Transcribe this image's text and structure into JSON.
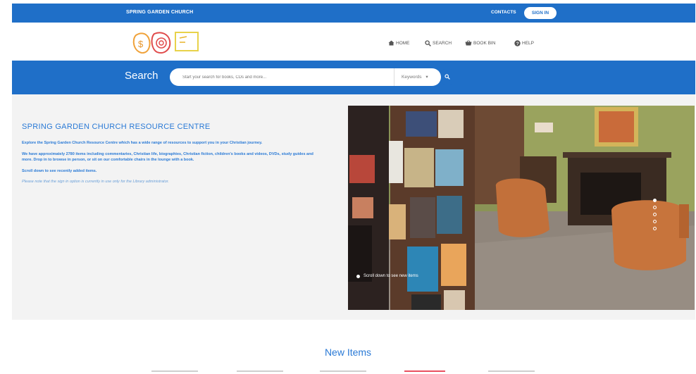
{
  "header": {
    "church_name": "SPRING GARDEN CHURCH",
    "contacts_label": "CONTACTS",
    "signin_label": "SIGN IN"
  },
  "nav": {
    "items": [
      {
        "label": "HOME",
        "icon": "home-icon"
      },
      {
        "label": "SEARCH",
        "icon": "search-icon"
      },
      {
        "label": "BOOK BIN",
        "icon": "basket-icon"
      },
      {
        "label": "HELP",
        "icon": "help-icon"
      }
    ]
  },
  "search": {
    "label": "Search",
    "placeholder": "Start your search for books, CDs and more...",
    "scope_selected": "Keywords"
  },
  "intro": {
    "title": "SPRING GARDEN CHURCH RESOURCE CENTRE",
    "p1": "Explore the Spring Garden Church Resource Centre which has a wide range of resources to support you in your Christian journey.",
    "p2": "We have approximately 2780 items including commentaries, Christian life, biographies, Christian fiction, children's books and videos, DVDs, study guides and more. Drop in to browse in person, or sit on our comfortable chairs in the lounge with a book.",
    "p3": "Scroll down to see recently added items.",
    "note": "Please note that the sign in option is currently in use only for the Library administrator."
  },
  "carousel": {
    "caption": "Scroll down to see new items",
    "slide_count": 5,
    "active_slide": 1
  },
  "new_items": {
    "heading": "New Items"
  },
  "colors": {
    "brand_blue": "#1f6fc8",
    "text_blue": "#2a7ad6"
  }
}
